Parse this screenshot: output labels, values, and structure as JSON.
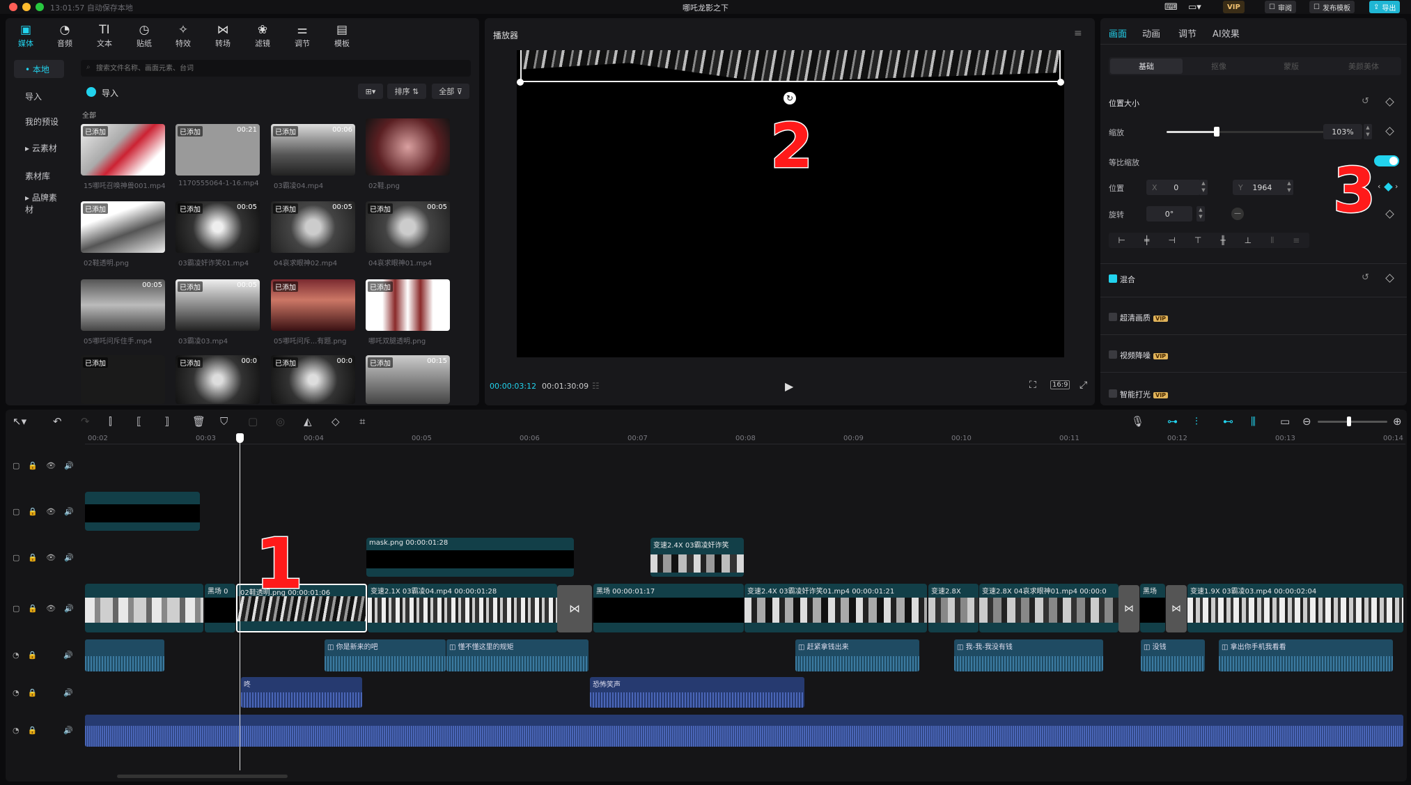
{
  "titlebar": {
    "status": "13:01:57 自动保存本地",
    "title": "哪吒龙影之下",
    "buttons": {
      "vip": "VIP",
      "review": "审阅",
      "publish": "发布模板",
      "export": "导出"
    }
  },
  "colors": {
    "accent": "#22d3ee",
    "track_video": "#123f48",
    "track_audio": "#1f4b63",
    "annotation_red": "#ff1a1a"
  },
  "media_toolbar": [
    {
      "label": "媒体",
      "icon": "media-icon"
    },
    {
      "label": "音频",
      "icon": "audio-icon"
    },
    {
      "label": "文本",
      "icon": "text-icon"
    },
    {
      "label": "贴纸",
      "icon": "sticker-icon"
    },
    {
      "label": "特效",
      "icon": "effects-icon"
    },
    {
      "label": "转场",
      "icon": "transition-icon"
    },
    {
      "label": "滤镜",
      "icon": "filter-icon"
    },
    {
      "label": "调节",
      "icon": "adjust-icon"
    },
    {
      "label": "模板",
      "icon": "template-icon"
    }
  ],
  "sidebar": {
    "items": [
      {
        "label": "• 本地"
      },
      {
        "label": "导入"
      },
      {
        "label": "我的预设"
      },
      {
        "label": "▸ 云素材"
      },
      {
        "label": "素材库"
      },
      {
        "label": "▸ 品牌素材"
      }
    ]
  },
  "media": {
    "search_placeholder": "搜索文件名称、画面元素、台词",
    "import_label": "导入",
    "sort_label": "排序",
    "filter_label": "全部",
    "section_label": "全部",
    "items": [
      {
        "name": "15哪吒召唤神兽001.mp4",
        "tag": "已添加",
        "duration": ""
      },
      {
        "name": "1170555064-1-16.mp4",
        "tag": "已添加",
        "duration": "00:21"
      },
      {
        "name": "03霸凌04.mp4",
        "tag": "已添加",
        "duration": "00:06"
      },
      {
        "name": "02鞋.png",
        "tag": "",
        "duration": ""
      },
      {
        "name": "02鞋透明.png",
        "tag": "已添加",
        "duration": ""
      },
      {
        "name": "03霸凌奸诈笑01.mp4",
        "tag": "已添加",
        "duration": "00:05"
      },
      {
        "name": "04哀求眼神02.mp4",
        "tag": "已添加",
        "duration": "00:05"
      },
      {
        "name": "04哀求眼神01.mp4",
        "tag": "已添加",
        "duration": "00:05"
      },
      {
        "name": "05哪吒问斥住手.mp4",
        "tag": "",
        "duration": "00:05"
      },
      {
        "name": "03霸凌03.mp4",
        "tag": "已添加",
        "duration": "00:05"
      },
      {
        "name": "05哪吒问斥...有题.png",
        "tag": "已添加",
        "duration": ""
      },
      {
        "name": "哪吒双腿透明.png",
        "tag": "已添加",
        "duration": ""
      },
      {
        "name": "",
        "tag": "已添加",
        "duration": ""
      },
      {
        "name": "",
        "tag": "已添加",
        "duration": "00:0"
      },
      {
        "name": "",
        "tag": "已添加",
        "duration": "00:0"
      },
      {
        "name": "",
        "tag": "已添加",
        "duration": "00:15"
      }
    ]
  },
  "player": {
    "title": "播放器",
    "current_time": "00:00:03:12",
    "total_time": "00:01:30:09",
    "ratio": "16:9"
  },
  "inspector": {
    "tabs": [
      "画面",
      "动画",
      "调节",
      "AI效果"
    ],
    "subtabs": [
      "基础",
      "抠像",
      "蒙版",
      "美颜美体"
    ],
    "position_size": "位置大小",
    "scale_label": "缩放",
    "scale_value": "103%",
    "scale_level": 0.3,
    "uniform_scale": "等比缩放",
    "position_label": "位置",
    "x_label": "X",
    "x_value": "0",
    "y_label": "Y",
    "y_value": "1964",
    "rotate_label": "旋转",
    "rotate_value": "0°",
    "blend": "混合",
    "hd": "超清画质",
    "denoise": "视频降噪",
    "relight": "智能打光",
    "vip": "VIP"
  },
  "timeline": {
    "ruler": [
      "00:02",
      "00:03",
      "00:04",
      "00:05",
      "00:06",
      "00:07",
      "00:08",
      "00:09",
      "00:10",
      "00:11",
      "00:12",
      "00:13",
      "00:14"
    ],
    "clips": {
      "mask": "mask.png  00:00:01:28",
      "speed_top": "变速2.4X  03霸凌奸诈笑",
      "black1": "黑场  0",
      "shoe": "02鞋透明.png  00:00:01:06",
      "bully04": "变速2.1X  03霸凌04.mp4  00:00:01:28",
      "black2": "黑场  00:00:01:17",
      "laugh": "变速2.4X  03霸凌奸诈笑01.mp4  00:00:01:21",
      "s28": "变速2.8X",
      "beg": "变速2.8X  04哀求眼神01.mp4  00:00:0",
      "black3": "黑场",
      "bully03": "变速1.9X  03霸凌03.mp4  00:00:02:04"
    },
    "audio": {
      "a1": "你是新来的吧",
      "a2": "懂不懂这里的规矩",
      "a3": "赶紧拿钱出来",
      "a4": "我-我-我没有钱",
      "a5": "没钱",
      "a6": "拿出你手机我看看",
      "a7": "咚",
      "a8": "恐怖笑声"
    }
  },
  "annotations": {
    "n1": "1",
    "n2": "2",
    "n3": "3"
  }
}
